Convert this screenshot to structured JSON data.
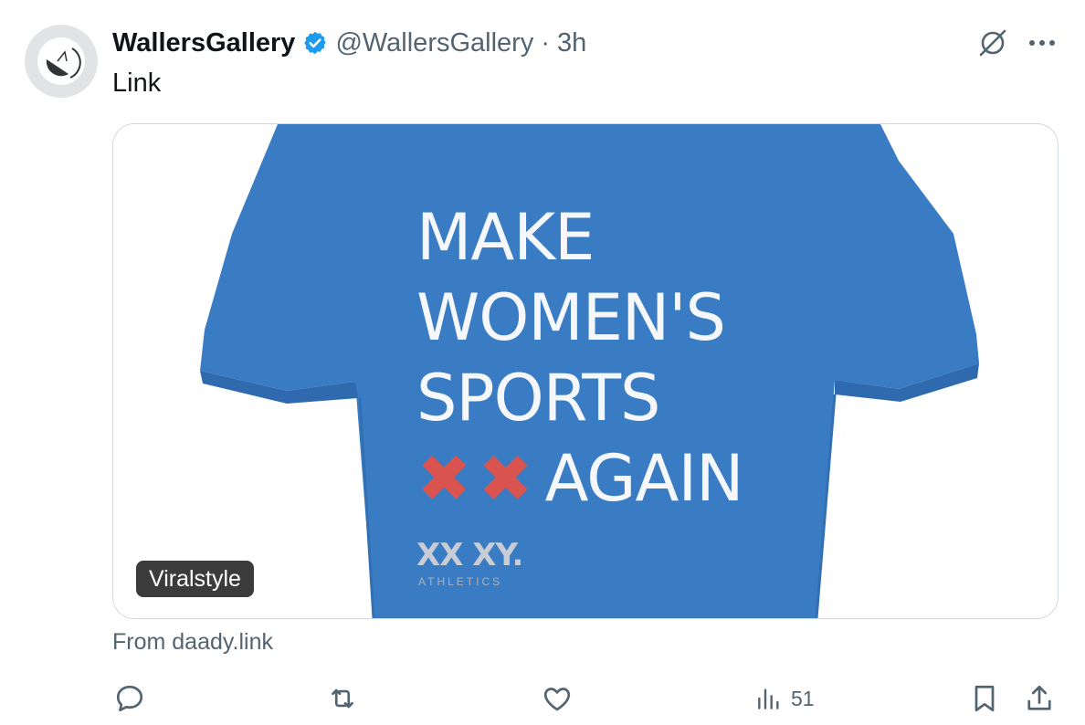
{
  "post": {
    "display_name": "WallersGallery",
    "handle": "@WallersGallery",
    "separator": "·",
    "time": "3h",
    "text": "Link"
  },
  "card": {
    "source_badge": "Viralstyle",
    "from_text": "From daady.link",
    "shirt": {
      "line1": "MAKE",
      "line2": "WOMEN'S",
      "line3": "SPORTS",
      "x_marks": [
        "✖",
        "✖"
      ],
      "line4": "AGAIN",
      "brand": "XX XY.",
      "brand_sub": "ATHLETICS",
      "shirt_color": "#3a7cc4"
    }
  },
  "actions": {
    "views_count": "51"
  },
  "colors": {
    "verified": "#1d9bf0",
    "secondary_text": "#536471",
    "card_border": "#cfd9de"
  },
  "icons": [
    "grok-icon",
    "more-icon",
    "reply-icon",
    "repost-icon",
    "like-icon",
    "views-icon",
    "bookmark-icon",
    "share-icon",
    "verified-badge-icon"
  ]
}
